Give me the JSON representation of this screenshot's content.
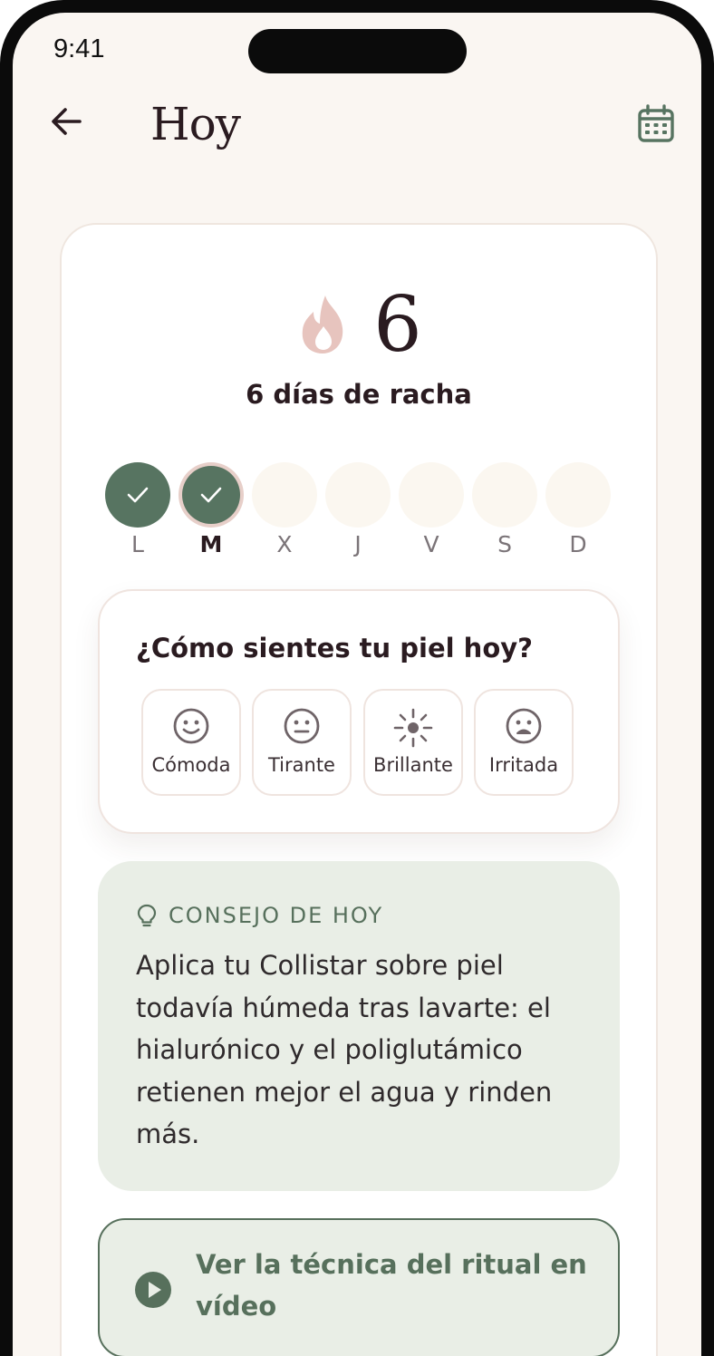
{
  "status_bar": {
    "time": "9:41"
  },
  "header": {
    "title": "Hoy"
  },
  "streak": {
    "count": "6",
    "label": "6 días de racha",
    "days": [
      {
        "label": "L",
        "done": true,
        "today": false
      },
      {
        "label": "M",
        "done": true,
        "today": true
      },
      {
        "label": "X",
        "done": false,
        "today": false
      },
      {
        "label": "J",
        "done": false,
        "today": false
      },
      {
        "label": "V",
        "done": false,
        "today": false
      },
      {
        "label": "S",
        "done": false,
        "today": false
      },
      {
        "label": "D",
        "done": false,
        "today": false
      }
    ]
  },
  "mood": {
    "question": "¿Cómo sientes tu piel hoy?",
    "options": [
      {
        "label": "Cómoda",
        "icon": "smile-icon"
      },
      {
        "label": "Tirante",
        "icon": "neutral-face-icon"
      },
      {
        "label": "Brillante",
        "icon": "shine-icon"
      },
      {
        "label": "Irritada",
        "icon": "sad-face-icon"
      }
    ]
  },
  "tip": {
    "heading": "CONSEJO DE HOY",
    "text": "Aplica tu Collistar sobre piel todavía húmeda tras lavarte: el hialurónico y el poliglutámico retienen mejor el agua y rinden más."
  },
  "video": {
    "label": "Ver la técnica del ritual en vídeo"
  },
  "colors": {
    "background": "#faf6f2",
    "accent_green": "#577461",
    "text_dark": "#2a1b20",
    "flame_pink": "#e7c4be",
    "tip_bg": "#e9eee6"
  }
}
